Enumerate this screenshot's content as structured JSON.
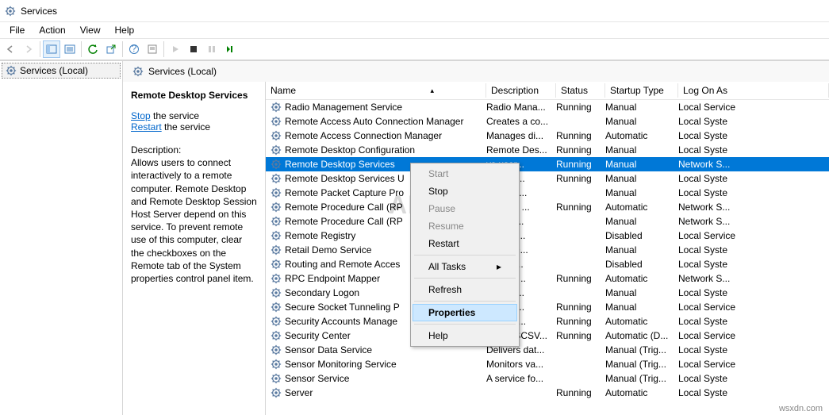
{
  "window": {
    "title": "Services"
  },
  "menu": {
    "file": "File",
    "action": "Action",
    "view": "View",
    "help": "Help"
  },
  "tree": {
    "root": "Services (Local)"
  },
  "content": {
    "header": "Services (Local)"
  },
  "columns": {
    "name": "Name",
    "desc": "Description",
    "status": "Status",
    "startup": "Startup Type",
    "logon": "Log On As"
  },
  "detail": {
    "title": "Remote Desktop Services",
    "stop": "Stop",
    "stop_tail": " the service",
    "restart": "Restart",
    "restart_tail": " the service",
    "desc_label": "Description:",
    "desc_body": "Allows users to connect interactively to a remote computer. Remote Desktop and Remote Desktop Session Host Server depend on this service.  To prevent remote use of this computer, clear the checkboxes on the Remote tab of the System properties control panel item."
  },
  "services": [
    {
      "name": "Radio Management Service",
      "desc": "Radio Mana...",
      "status": "Running",
      "startup": "Manual",
      "logon": "Local Service"
    },
    {
      "name": "Remote Access Auto Connection Manager",
      "desc": "Creates a co...",
      "status": "",
      "startup": "Manual",
      "logon": "Local Syste"
    },
    {
      "name": "Remote Access Connection Manager",
      "desc": "Manages di...",
      "status": "Running",
      "startup": "Automatic",
      "logon": "Local Syste"
    },
    {
      "name": "Remote Desktop Configuration",
      "desc": "Remote Des...",
      "status": "Running",
      "startup": "Manual",
      "logon": "Local Syste"
    },
    {
      "name": "Remote Desktop Services",
      "desc": "vs user...",
      "status": "Running",
      "startup": "Manual",
      "logon": "Network S...",
      "selected": true
    },
    {
      "name": "Remote Desktop Services U",
      "desc": "vs the r...",
      "status": "Running",
      "startup": "Manual",
      "logon": "Local Syste"
    },
    {
      "name": "Remote Packet Capture Pro",
      "desc": "vs to ca...",
      "status": "",
      "startup": "Manual",
      "logon": "Local Syste"
    },
    {
      "name": "Remote Procedure Call (RP",
      "desc": "RPCSS ...",
      "status": "Running",
      "startup": "Automatic",
      "logon": "Network S..."
    },
    {
      "name": "Remote Procedure Call (RP",
      "desc": "indows...",
      "status": "",
      "startup": "Manual",
      "logon": "Network S..."
    },
    {
      "name": "Remote Registry",
      "desc": "les rem...",
      "status": "",
      "startup": "Disabled",
      "logon": "Local Service"
    },
    {
      "name": "Retail Demo Service",
      "desc": "Retail D...",
      "status": "",
      "startup": "Manual",
      "logon": "Local Syste"
    },
    {
      "name": "Routing and Remote Acces",
      "desc": "rs routi...",
      "status": "",
      "startup": "Disabled",
      "logon": "Local Syste"
    },
    {
      "name": "RPC Endpoint Mapper",
      "desc": "lves RP...",
      "status": "Running",
      "startup": "Automatic",
      "logon": "Network S..."
    },
    {
      "name": "Secondary Logon",
      "desc": "les star...",
      "status": "",
      "startup": "Manual",
      "logon": "Local Syste"
    },
    {
      "name": "Secure Socket Tunneling P",
      "desc": "ides su...",
      "status": "Running",
      "startup": "Manual",
      "logon": "Local Service"
    },
    {
      "name": "Security Accounts Manage",
      "desc": "startup ...",
      "status": "Running",
      "startup": "Automatic",
      "logon": "Local Syste"
    },
    {
      "name": "Security Center",
      "desc": "The WSCSV...",
      "status": "Running",
      "startup": "Automatic (D...",
      "logon": "Local Service"
    },
    {
      "name": "Sensor Data Service",
      "desc": "Delivers dat...",
      "status": "",
      "startup": "Manual (Trig...",
      "logon": "Local Syste"
    },
    {
      "name": "Sensor Monitoring Service",
      "desc": "Monitors va...",
      "status": "",
      "startup": "Manual (Trig...",
      "logon": "Local Service"
    },
    {
      "name": "Sensor Service",
      "desc": "A service fo...",
      "status": "",
      "startup": "Manual (Trig...",
      "logon": "Local Syste"
    },
    {
      "name": "Server",
      "desc": "",
      "status": "Running",
      "startup": "Automatic",
      "logon": "Local Syste"
    }
  ],
  "context_menu": {
    "start": "Start",
    "stop": "Stop",
    "pause": "Pause",
    "resume": "Resume",
    "restart": "Restart",
    "all_tasks": "All Tasks",
    "refresh": "Refresh",
    "properties": "Properties",
    "help": "Help"
  },
  "watermarks": {
    "big": "ALS",
    "corner": "wsxdn.com"
  }
}
